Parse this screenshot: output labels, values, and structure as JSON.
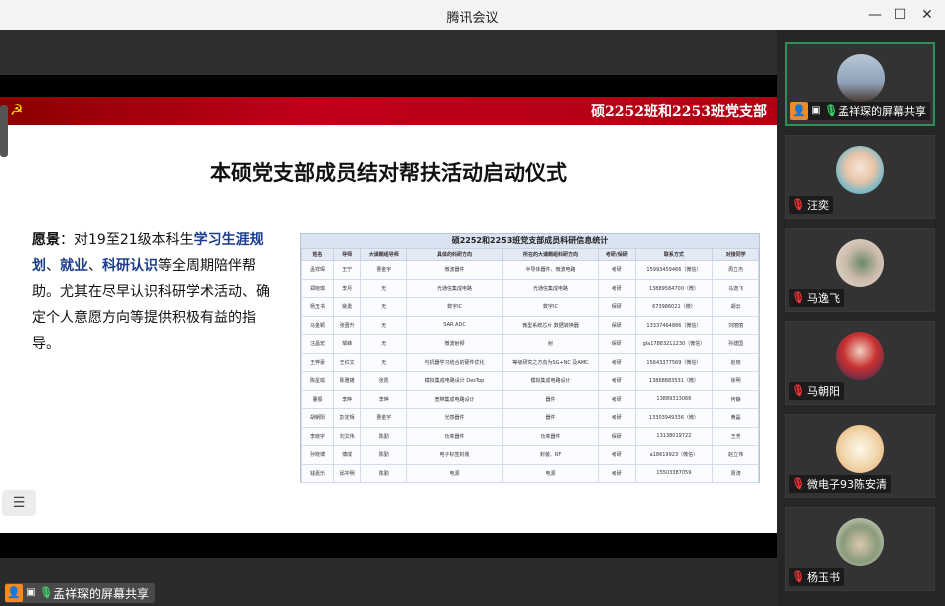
{
  "window": {
    "title": "腾讯会议",
    "minimize": "—",
    "restore": "☐",
    "close": "✕"
  },
  "slide": {
    "org": "硕2252班和2253班党支部",
    "title": "本硕党支部成员结对帮扶活动启动仪式",
    "vision": {
      "label": "愿景",
      "p1": "：对19至21级本科生",
      "hl1": "学习生涯规划",
      "p2": "、",
      "hl2": "就业",
      "p3": "、",
      "hl3": "科研认识",
      "p4": "等全周期陪伴帮助。尤其在尽早认识科研学术活动、确定个人意愿方向等提供积极有益的指导。"
    },
    "table": {
      "title": "硕2252和2253班党支部成员科研信息统计",
      "headers": [
        "姓名",
        "导师",
        "大课题组导师",
        "具体的科研方向",
        "所在的大课题组科研方向",
        "考研/保研",
        "联系方式",
        "对接同学"
      ],
      "rows": [
        [
          "孟祥琛",
          "王宁",
          "曹金宇",
          "微波器件",
          "半导体器件、微波电路",
          "考研",
          "15993459466（微信）",
          "周立杰"
        ],
        [
          "郑晓琪",
          "李月",
          "无",
          "光通信集成电路",
          "光通信集成电路",
          "考研",
          "13889584700（微）",
          "马逸飞"
        ],
        [
          "杨玉书",
          "姚勇",
          "无",
          "数字IC",
          "数字IC",
          "保研",
          "673986021（微）",
          "胡云"
        ],
        [
          "马金颖",
          "张晋升",
          "无",
          "SAR ADC",
          "微型系统芯片 数据转换器",
          "保研",
          "13337464886（微信）",
          "刘丽丽"
        ],
        [
          "汪昌宏",
          "邹峰",
          "无",
          "微波射频",
          "射",
          "保研",
          "gla17883211230（微信）",
          "孙建国"
        ],
        [
          "王梓豪",
          "王红文",
          "无",
          "与机器学习结合的硬件优化",
          "等级研究之方向为SG+NC 及AMC",
          "考研",
          "15643377569（微信）",
          "赵晓"
        ],
        [
          "陈星瑜",
          "陈雅雄",
          "张凯",
          "模拟集成电路设计 DesTop",
          "模拟集成电路设计",
          "考研",
          "13868883531（微）",
          "徐明"
        ],
        [
          "董振",
          "李晔",
          "李晔",
          "宽带集成电路设计",
          "器件",
          "考研",
          "13889313066",
          "何静"
        ],
        [
          "胡朝阳",
          "彭定辉",
          "曹金宇",
          "光感器件",
          "器件",
          "考研",
          "13303949336（微）",
          "黄磊"
        ],
        [
          "李晓宇",
          "刘文伟",
          "陈勤",
          "功率器件",
          "功率器件",
          "保研",
          "13138019722",
          "王芳"
        ],
        [
          "孙晓博",
          "傅成",
          "陈勤",
          "电子标签封装",
          "封装、RF",
          "考研",
          "a18619923（微信）",
          "赵立伟"
        ],
        [
          "钱嘉乐",
          "邱冲明",
          "陈勤",
          "电源",
          "电源",
          "考研",
          "15503387059",
          "周涛"
        ]
      ]
    }
  },
  "presenter_bar": {
    "label": "孟祥琛的屏幕共享"
  },
  "participants": [
    {
      "name": "孟祥琛的屏幕共享",
      "sharing": true,
      "mic_on": true
    },
    {
      "name": "汪奕",
      "sharing": false,
      "mic_on": false
    },
    {
      "name": "马逸飞",
      "sharing": false,
      "mic_on": false
    },
    {
      "name": "马朝阳",
      "sharing": false,
      "mic_on": false
    },
    {
      "name": "微电子93陈安清",
      "sharing": false,
      "mic_on": false
    },
    {
      "name": "杨玉书",
      "sharing": false,
      "mic_on": false
    }
  ],
  "colors": {
    "share_green": "#2f8f5a",
    "header_red": "#c0001a",
    "highlight_blue": "#1a3c8a",
    "user_orange": "#f08a24"
  }
}
